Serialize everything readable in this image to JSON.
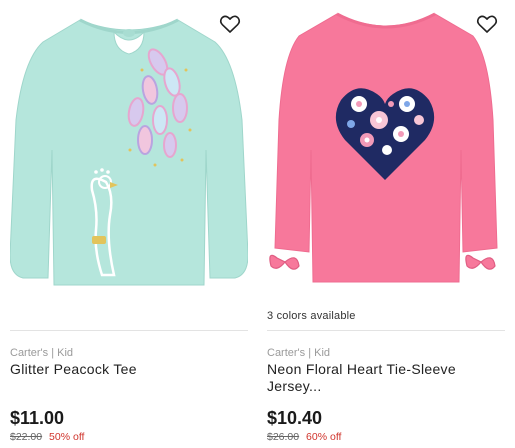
{
  "products": [
    {
      "brand": "Carter's | Kid",
      "name": "Glitter Peacock Tee",
      "price": "$11.00",
      "original_price": "$22.00",
      "discount": "50% off",
      "colors_available": "",
      "favorite_icon": "heart-outline-icon",
      "image": {
        "shirt_color": "#b5e6dc",
        "graphic": "peacock"
      }
    },
    {
      "brand": "Carter's | Kid",
      "name": "Neon Floral Heart Tie-Sleeve Jersey...",
      "price": "$10.40",
      "original_price": "$26.00",
      "discount": "60% off",
      "colors_available": "3 colors available",
      "favorite_icon": "heart-outline-icon",
      "image": {
        "shirt_color": "#f7789b",
        "graphic": "floral-heart"
      }
    }
  ],
  "colors": {
    "discount": "#d0342c",
    "brand_text": "#9a9a9a",
    "divider": "#e3e3e3"
  }
}
